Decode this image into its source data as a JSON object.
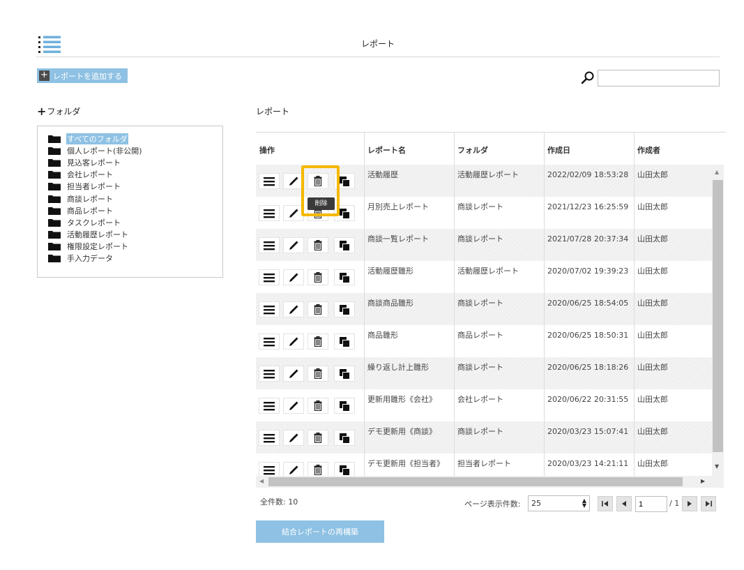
{
  "header": {
    "title": "レポート",
    "menu_icon": "list-menu-icon"
  },
  "toolbar": {
    "add_report_label": "レポートを追加する",
    "search_placeholder": "",
    "search_value": ""
  },
  "folders": {
    "heading": "フォルダ",
    "items": [
      {
        "label": "すべてのフォルダ",
        "selected": true
      },
      {
        "label": "個人レポート(非公開)"
      },
      {
        "label": "見込客レポート"
      },
      {
        "label": "会社レポート"
      },
      {
        "label": "担当者レポート"
      },
      {
        "label": "商談レポート"
      },
      {
        "label": "商品レポート"
      },
      {
        "label": "タスクレポート"
      },
      {
        "label": "活動履歴レポート"
      },
      {
        "label": "権限設定レポート"
      },
      {
        "label": "手入力データ"
      }
    ]
  },
  "reports": {
    "heading": "レポート",
    "columns": [
      "操作",
      "レポート名",
      "フォルダ",
      "作成日",
      "作成者"
    ],
    "rows": [
      {
        "name": "活動履歴",
        "folder": "活動履歴レポート",
        "created": "2022/02/09 18:53:28",
        "author": "山田太郎"
      },
      {
        "name": "月別売上レポート",
        "folder": "商談レポート",
        "created": "2021/12/23 16:25:59",
        "author": "山田太郎"
      },
      {
        "name": "商談一覧レポート",
        "folder": "商談レポート",
        "created": "2021/07/28 20:37:34",
        "author": "山田太郎"
      },
      {
        "name": "活動履歴雛形",
        "folder": "活動履歴レポート",
        "created": "2020/07/02 19:39:23",
        "author": "山田太郎"
      },
      {
        "name": "商談商品雛形",
        "folder": "商談レポート",
        "created": "2020/06/25 18:54:05",
        "author": "山田太郎"
      },
      {
        "name": "商品雛形",
        "folder": "商品レポート",
        "created": "2020/06/25 18:50:31",
        "author": "山田太郎"
      },
      {
        "name": "繰り返し計上雛形",
        "folder": "商談レポート",
        "created": "2020/06/25 18:18:26",
        "author": "山田太郎"
      },
      {
        "name": "更新用雛形《会社》",
        "folder": "会社レポート",
        "created": "2020/06/22 20:31:55",
        "author": "山田太郎"
      },
      {
        "name": "デモ更新用《商談》",
        "folder": "商談レポート",
        "created": "2020/03/23 15:07:41",
        "author": "山田太郎"
      },
      {
        "name": "デモ更新用《担当者》",
        "folder": "担当者レポート",
        "created": "2020/03/23 14:21:11",
        "author": "山田太郎"
      }
    ],
    "row_actions": [
      "menu-icon",
      "edit-pencil-icon",
      "delete-trash-icon",
      "copy-icon"
    ],
    "tooltip": "削除"
  },
  "pagination": {
    "total_label": "全件数: 10",
    "page_size_label": "ページ表示件数:",
    "page_size": "25",
    "current_page": "1",
    "total_pages_label": "/ 1"
  },
  "footer": {
    "rebuild_label": "結合レポートの再構築"
  },
  "colors": {
    "accent": "#8ec1e3",
    "highlight": "#f5b800"
  }
}
